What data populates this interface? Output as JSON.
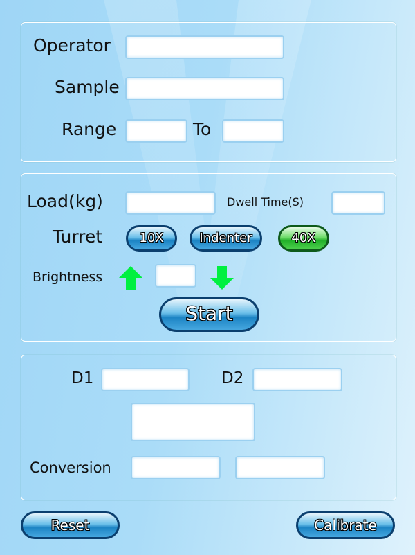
{
  "identity": {
    "operator_label": "Operator",
    "operator_value": "",
    "sample_label": "Sample",
    "sample_value": "",
    "range_label": "Range",
    "range_from": "",
    "range_to_label": "To",
    "range_to": ""
  },
  "test": {
    "load_label": "Load(kg)",
    "load_value": "",
    "dwell_label": "Dwell Time(S)",
    "dwell_value": "",
    "turret_label": "Turret",
    "turret_options": [
      "10X",
      "Indenter",
      "40X"
    ],
    "turret_selected": "40X",
    "brightness_label": "Brightness",
    "brightness_value": "",
    "brightness_up_icon": "arrow-up-icon",
    "brightness_down_icon": "arrow-down-icon",
    "start_label": "Start"
  },
  "results": {
    "d1_label": "D1",
    "d1_value": "",
    "d2_label": "D2",
    "d2_value": "",
    "result_value": "",
    "conversion_label": "Conversion",
    "conversion_value1": "",
    "conversion_value2": ""
  },
  "footer": {
    "reset_label": "Reset",
    "calibrate_label": "Calibrate"
  },
  "colors": {
    "accent_blue": "#1c84c4",
    "selected_green": "#22b02a",
    "arrow_green": "#00f040"
  }
}
